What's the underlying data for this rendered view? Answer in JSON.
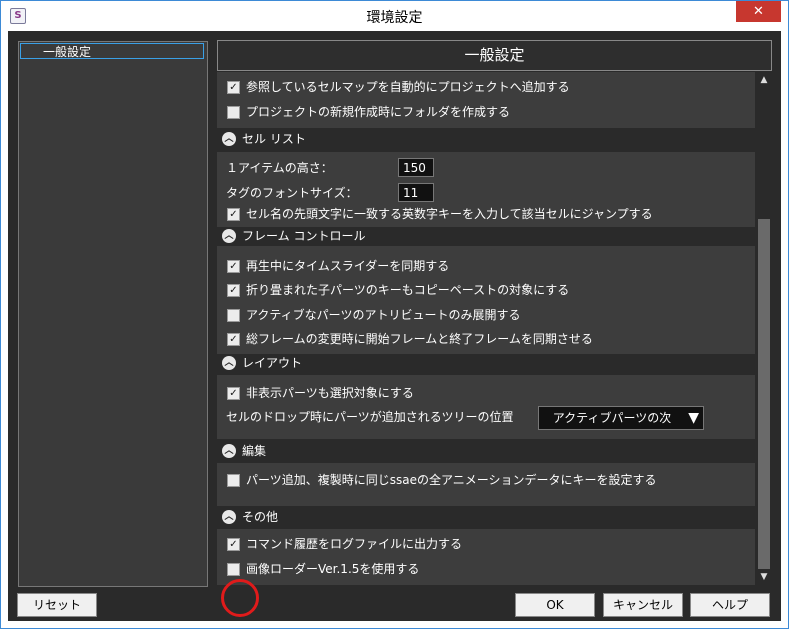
{
  "window": {
    "title": "環境設定",
    "close_glyph": "✕",
    "app_icon_glyph": "S"
  },
  "sidebar": {
    "items": [
      {
        "label": "一般設定"
      }
    ]
  },
  "panel": {
    "title": "一般設定"
  },
  "sections": {
    "project": {
      "items": [
        {
          "label": "参照しているセルマップを自動的にプロジェクトへ追加する",
          "checked": true
        },
        {
          "label": "プロジェクトの新規作成時にフォルダを作成する",
          "checked": false
        }
      ]
    },
    "cell_list": {
      "title": "セル リスト",
      "item_height_label": "１アイテムの高さ：",
      "item_height_value": "150",
      "tag_font_label": "タグのフォントサイズ：",
      "tag_font_value": "11",
      "jump_label": "セル名の先頭文字に一致する英数字キーを入力して該当セルにジャンプする",
      "jump_checked": true
    },
    "frame_control": {
      "title": "フレーム コントロール",
      "items": [
        {
          "label": "再生中にタイムスライダーを同期する",
          "checked": true
        },
        {
          "label": "折り畳まれた子パーツのキーもコピーペーストの対象にする",
          "checked": true
        },
        {
          "label": "アクティブなパーツのアトリビュートのみ展開する",
          "checked": false
        },
        {
          "label": "総フレームの変更時に開始フレームと終了フレームを同期させる",
          "checked": true
        }
      ]
    },
    "layout": {
      "title": "レイアウト",
      "hidden_label": "非表示パーツも選択対象にする",
      "hidden_checked": true,
      "drop_label": "セルのドロップ時にパーツが追加されるツリーの位置",
      "drop_value": "アクティブパーツの次",
      "drop_arrow": "▼"
    },
    "edit": {
      "title": "編集",
      "items": [
        {
          "label": "パーツ追加、複製時に同じssaeの全アニメーションデータにキーを設定する",
          "checked": false
        }
      ]
    },
    "other": {
      "title": "その他",
      "items": [
        {
          "label": "コマンド履歴をログファイルに出力する",
          "checked": true
        },
        {
          "label": "画像ローダーVer.1.5を使用する",
          "checked": false
        }
      ]
    }
  },
  "glyphs": {
    "check": "✓",
    "chevron_up": "︿",
    "scroll_up": "▲",
    "scroll_down": "▼"
  },
  "buttons": {
    "reset": "リセット",
    "ok": "OK",
    "cancel": "キャンセル",
    "help": "ヘルプ"
  },
  "colors": {
    "highlight_circle": "#e01b1b",
    "accent": "#3aa0e6",
    "close": "#c7372f"
  }
}
